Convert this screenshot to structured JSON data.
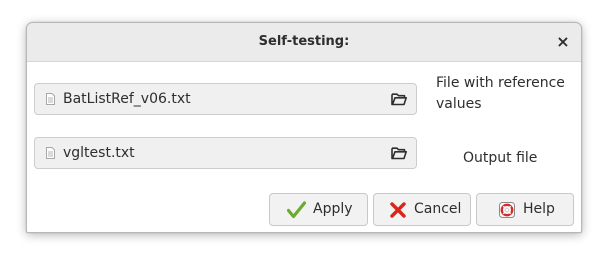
{
  "dialog": {
    "title": "Self-testing:",
    "close_glyph": "×",
    "rows": [
      {
        "file": "BatListRef_v06.txt",
        "label": "File with reference values",
        "icons": [
          "text-file-icon",
          "folder-open-icon"
        ]
      },
      {
        "file": "vgltest.txt",
        "label": "Output file",
        "icons": [
          "text-file-icon",
          "folder-open-icon"
        ]
      }
    ],
    "buttons": {
      "apply": {
        "label": "Apply",
        "icon": "checkmark-icon",
        "color": "#6bab2e"
      },
      "cancel": {
        "label": "Cancel",
        "icon": "red-x-icon",
        "color": "#d8261a"
      },
      "help": {
        "label": "Help",
        "icon": "lifebuoy-icon",
        "color": "#d42a2a"
      }
    }
  }
}
